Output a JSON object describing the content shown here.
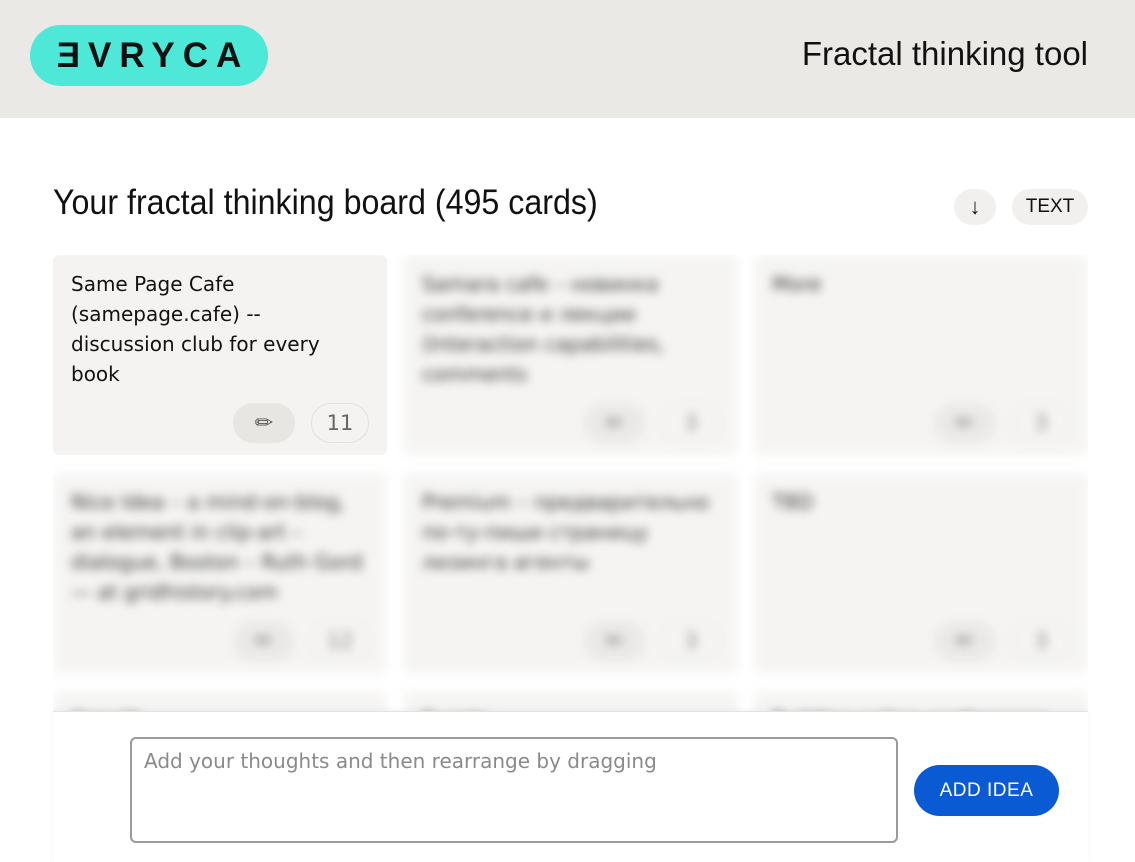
{
  "header": {
    "logo_text": "ƎVRYCA",
    "title": "Fractal thinking tool"
  },
  "board": {
    "title": "Your fractal thinking board (495 cards)",
    "sort_icon": "↓",
    "text_button": "TEXT"
  },
  "cards": [
    {
      "text": "Same Page Cafe (samepage.cafe) -- discussion club for every book",
      "edit_icon": "✏",
      "count": "11"
    },
    {
      "text": "Samara cafe – новинка conference и лекции (Interaction capabilities, comments",
      "edit_icon": "✏",
      "count": "3"
    },
    {
      "text": "More",
      "edit_icon": "✏",
      "count": "3"
    },
    {
      "text": "Nice Idea – a mind-on-blog, an element in clip-art – dialogue, Boston – Ruth Gord — at gridhistory.com",
      "edit_icon": "✏",
      "count": "12"
    },
    {
      "text": "Premium – предварительно по-ту-пиши страницу лизинга агенты",
      "edit_icon": "✏",
      "count": "3"
    },
    {
      "text": "TBD",
      "edit_icon": "✏",
      "count": "3"
    },
    {
      "text": "Growth",
      "edit_icon": "✏",
      "count": ""
    },
    {
      "text": "Events",
      "edit_icon": "✏",
      "count": ""
    },
    {
      "text": "Building online conferences",
      "edit_icon": "✏",
      "count": ""
    }
  ],
  "composer": {
    "placeholder": "Add your thoughts and then rearrange by dragging",
    "add_button": "ADD IDEA"
  }
}
